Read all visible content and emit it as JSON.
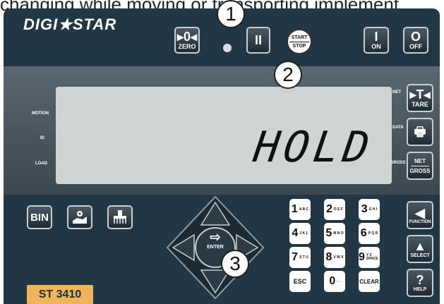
{
  "caption": "changing while moving or transporting implement",
  "brand": "DIGI★STAR",
  "buttons": {
    "zero": {
      "sym": "▸0◂",
      "lbl": "ZERO"
    },
    "pause": {
      "sym": "II"
    },
    "startstop": {
      "top": "START",
      "bottom": "STOP"
    },
    "on": {
      "sym": "I",
      "lbl": "ON"
    },
    "off": {
      "sym": "O",
      "lbl": "OFF"
    },
    "tare": {
      "sym": "▸T◂",
      "lbl": "TARE"
    },
    "print": {
      "sym": "🖶"
    },
    "netgross": {
      "top": "NET",
      "bottom": "GROSS"
    },
    "bin": {
      "lbl": "BIN"
    },
    "function": {
      "sym": "◀",
      "lbl": "FUNCTION"
    },
    "select": {
      "sym": "▲",
      "lbl": "SELECT"
    },
    "help": {
      "sym": "?",
      "lbl": "HELP"
    },
    "enter": {
      "sym": "⇨",
      "lbl": "ENTER"
    }
  },
  "display": {
    "text": "HOLD",
    "left_labels": [
      "MOTION",
      "ID",
      "LOAD"
    ],
    "right_labels": [
      "NET",
      "DATA",
      "GROSS"
    ]
  },
  "keypad": [
    {
      "key": "1",
      "sub": "A B C"
    },
    {
      "key": "2",
      "sub": "D E F"
    },
    {
      "key": "3",
      "sub": "G H I"
    },
    {
      "key": "4",
      "sub": "J K L"
    },
    {
      "key": "5",
      "sub": "M N O"
    },
    {
      "key": "6",
      "sub": "P Q R"
    },
    {
      "key": "7",
      "sub": "S T U"
    },
    {
      "key": "8",
      "sub": "V W X"
    },
    {
      "key": "9",
      "sub": "Y Z SPACE"
    },
    {
      "key": "ESC",
      "sub": ""
    },
    {
      "key": "0",
      "sub": "- ."
    },
    {
      "key": "CLEAR",
      "sub": ""
    }
  ],
  "callouts": [
    "1",
    "2",
    "3"
  ],
  "model": "ST 3410",
  "colors": {
    "panel": "#223746",
    "lcd": "#cfd5d3",
    "model_tag": "#f0b55a",
    "callout_bg": "#ffffff"
  }
}
